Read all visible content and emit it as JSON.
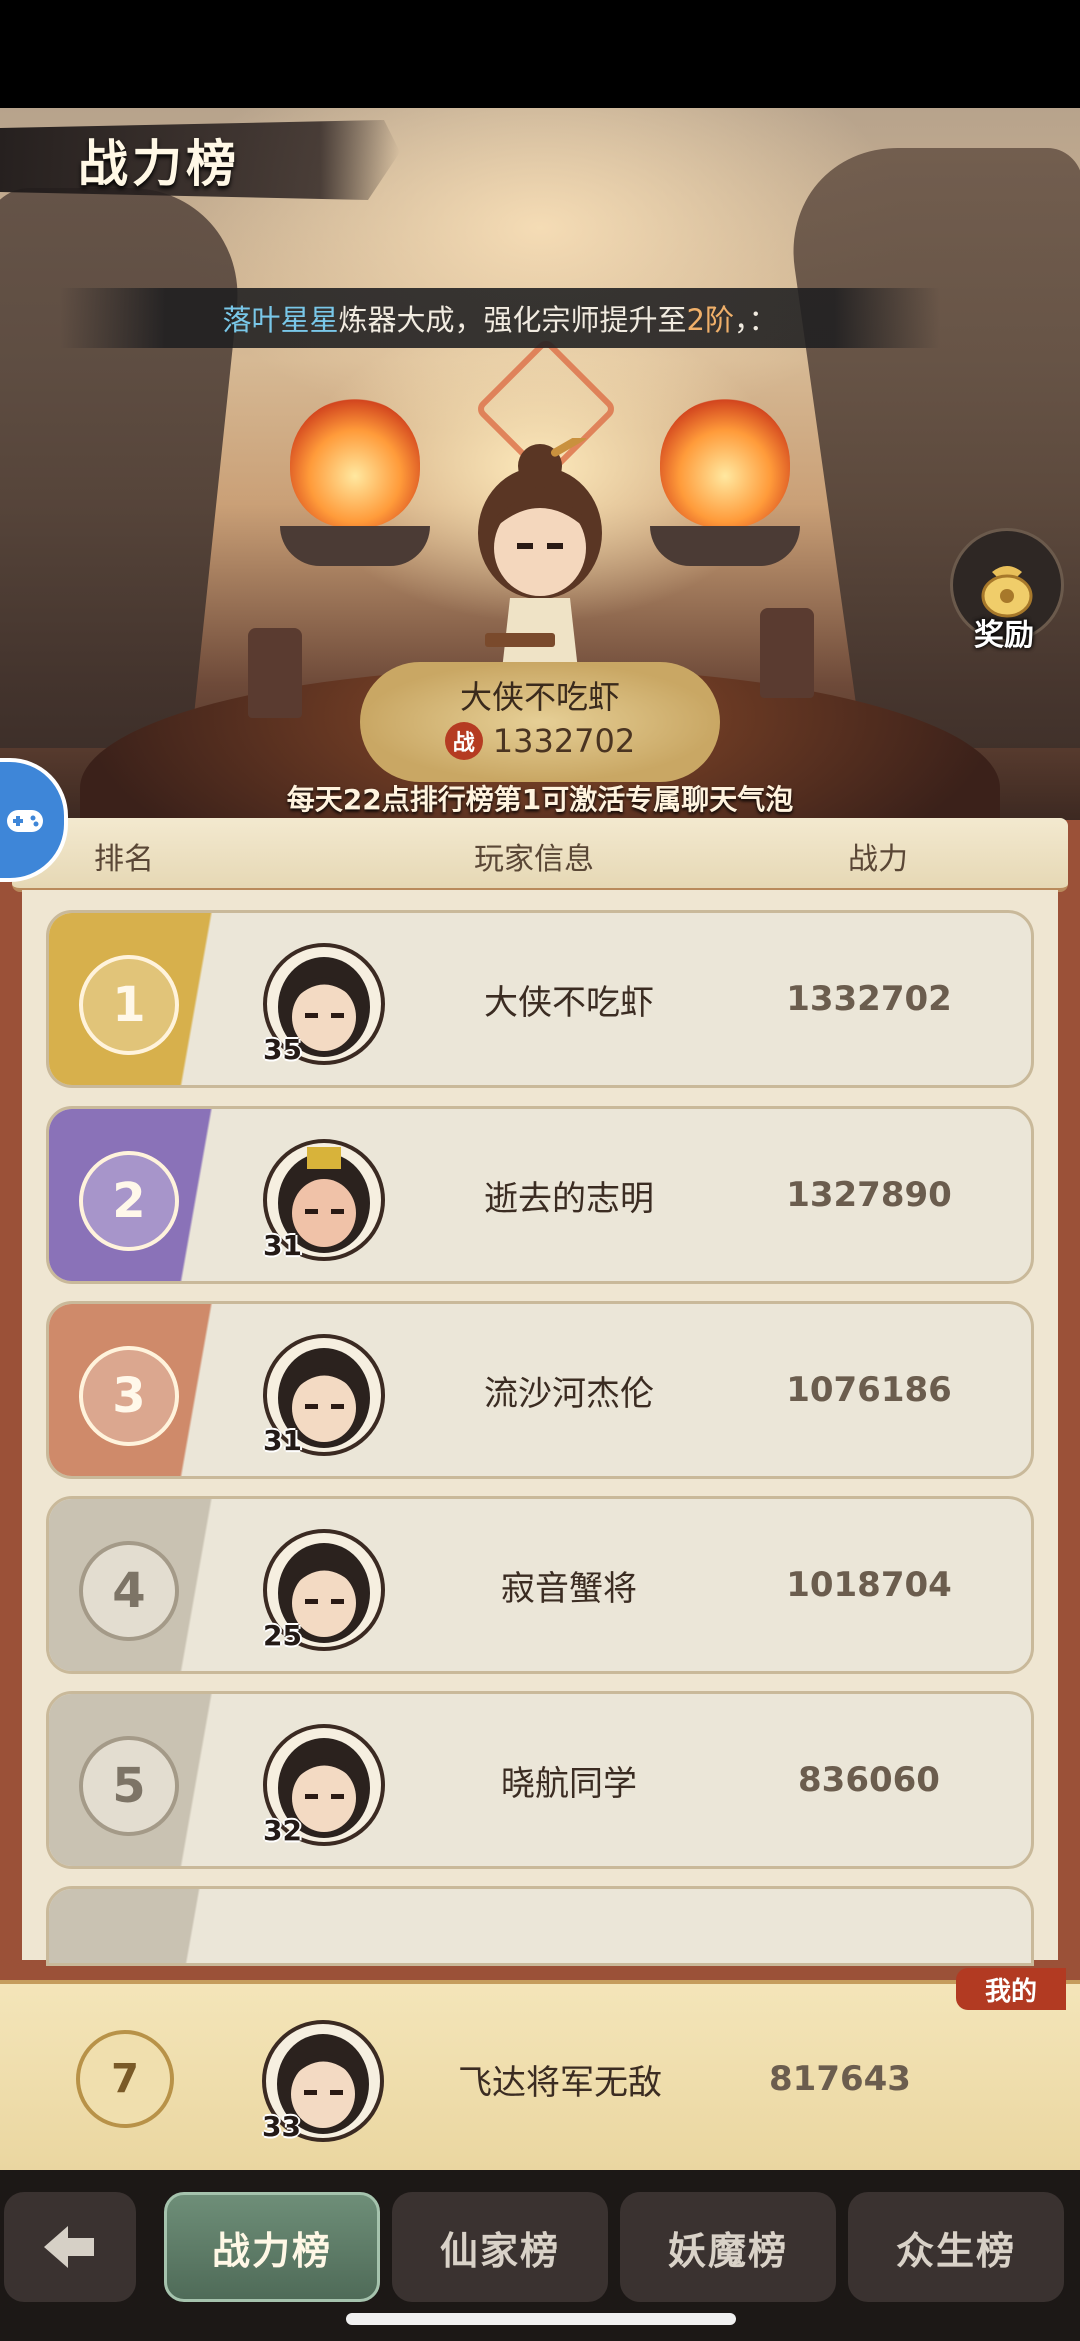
{
  "header": {
    "title": "战力榜"
  },
  "marquee": {
    "name": "落叶星星",
    "text_a": "炼器大成，强化宗师提升至",
    "level": "2阶",
    "text_b": "，："
  },
  "reward": {
    "label": "奖励"
  },
  "champion": {
    "name": "大侠不吃虾",
    "badge": "战",
    "power": "1332702"
  },
  "notice": "每天22点排行榜第1可激活专属聊天气泡",
  "columns": {
    "rank": "排名",
    "player": "玩家信息",
    "power": "战力"
  },
  "rankings": [
    {
      "rank": "1",
      "level": "35",
      "name": "大侠不吃虾",
      "power": "1332702"
    },
    {
      "rank": "2",
      "level": "31",
      "name": "逝去的志明",
      "power": "1327890"
    },
    {
      "rank": "3",
      "level": "31",
      "name": "流沙河杰伦",
      "power": "1076186"
    },
    {
      "rank": "4",
      "level": "25",
      "name": "寂音蟹将",
      "power": "1018704"
    },
    {
      "rank": "5",
      "level": "32",
      "name": "晓航同学",
      "power": "836060"
    }
  ],
  "my_rank": {
    "tag": "我的",
    "rank": "7",
    "level": "33",
    "name": "飞达将军无敌",
    "power": "817643"
  },
  "tabs": [
    {
      "label": "战力榜",
      "active": true
    },
    {
      "label": "仙家榜",
      "active": false
    },
    {
      "label": "妖魔榜",
      "active": false
    },
    {
      "label": "众生榜",
      "active": false
    }
  ],
  "colors": {
    "gold": "#d7b04c",
    "purple": "#8a72b8",
    "bronze": "#cf8a6a",
    "grey": "#c9c2b2",
    "accent_red": "#b23a22"
  },
  "icons": {
    "back": "arrow-left-icon",
    "float": "gamepad-icon",
    "reward": "money-bag-icon"
  }
}
